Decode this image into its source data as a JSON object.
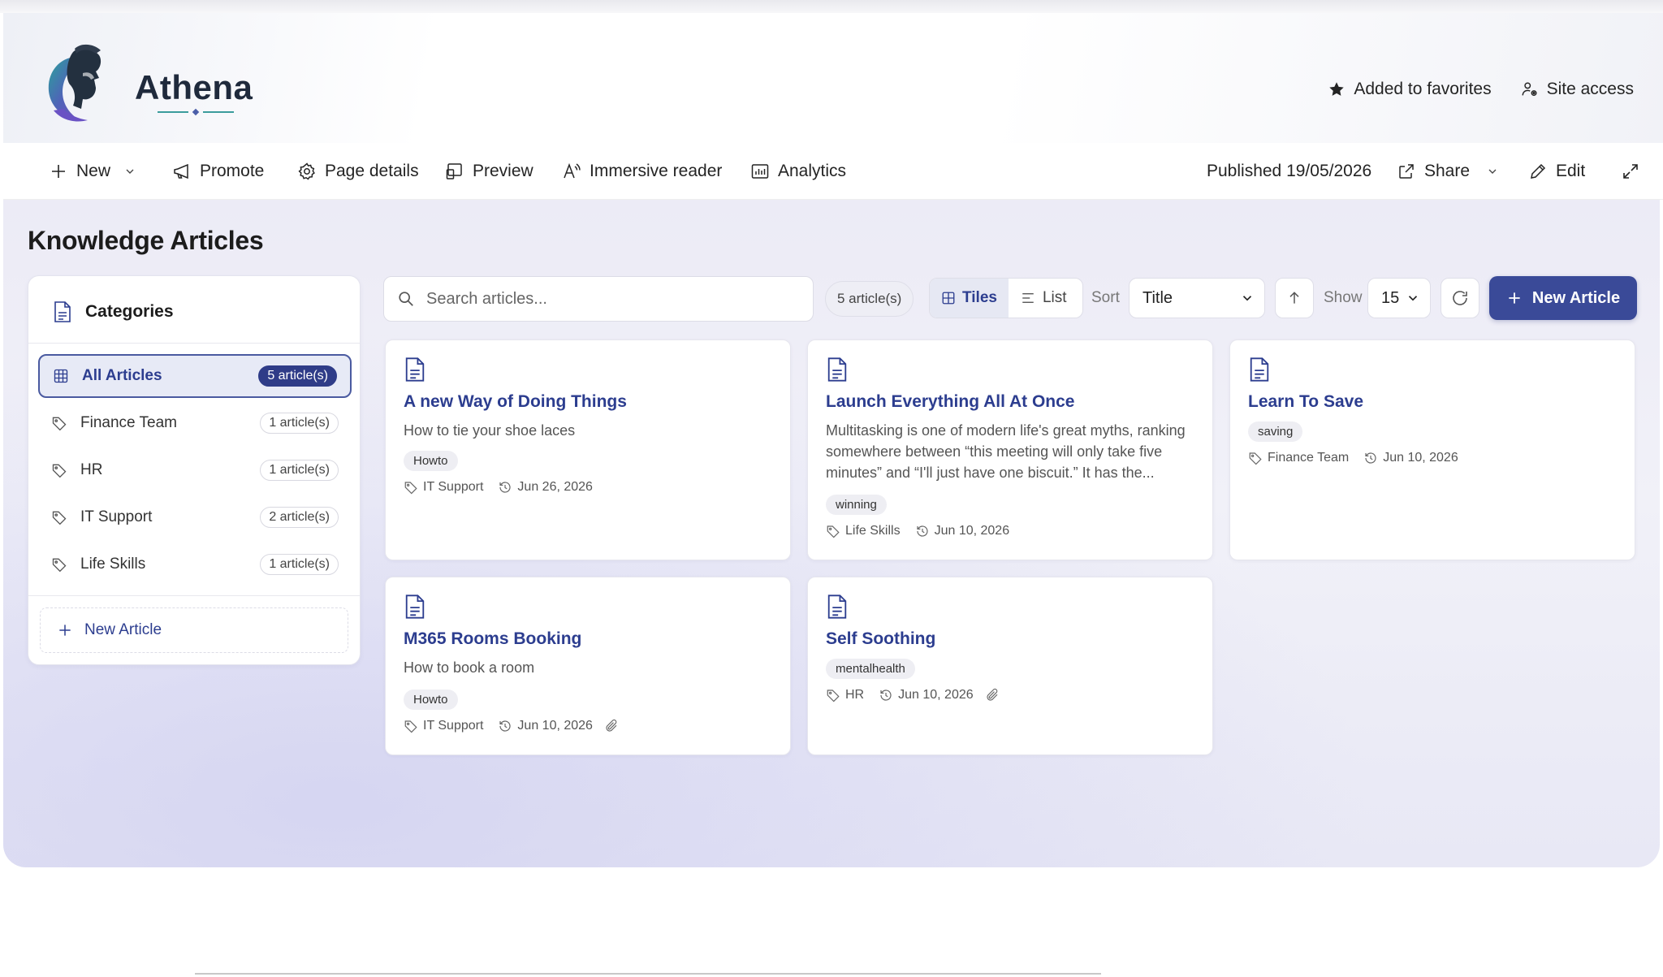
{
  "site": {
    "title": "Athena",
    "favorite_label": "Added to favorites",
    "site_access_label": "Site access"
  },
  "command_bar": {
    "new_label": "New",
    "promote_label": "Promote",
    "page_details_label": "Page details",
    "preview_label": "Preview",
    "immersive_reader_label": "Immersive reader",
    "analytics_label": "Analytics",
    "published_label": "Published 19/05/2026",
    "share_label": "Share",
    "edit_label": "Edit"
  },
  "page": {
    "title": "Knowledge Articles"
  },
  "sidebar": {
    "header": "Categories",
    "items": [
      {
        "label": "All Articles",
        "count": "5 article(s)",
        "active": true
      },
      {
        "label": "Finance Team",
        "count": "1 article(s)"
      },
      {
        "label": "HR",
        "count": "1 article(s)"
      },
      {
        "label": "IT Support",
        "count": "2 article(s)"
      },
      {
        "label": "Life Skills",
        "count": "1 article(s)"
      }
    ],
    "new_article_label": "New Article"
  },
  "toolbar": {
    "search_placeholder": "Search articles...",
    "article_count": "5 article(s)",
    "tiles_label": "Tiles",
    "list_label": "List",
    "sort_label": "Sort",
    "sort_value": "Title",
    "show_label": "Show",
    "show_value": "15",
    "new_article_label": "New Article"
  },
  "articles": [
    {
      "title": "A new Way of Doing Things",
      "description": "How to tie your shoe laces",
      "tag": "Howto",
      "category": "IT Support",
      "date": "Jun 26, 2026",
      "attachment": false
    },
    {
      "title": "Launch Everything All At Once",
      "description": "Multitasking is one of modern life's great myths, ranking somewhere between “this meeting will only take five minutes” and “I'll just have one biscuit.” It has the...",
      "tag": "winning",
      "category": "Life Skills",
      "date": "Jun 10, 2026",
      "attachment": false
    },
    {
      "title": "Learn To Save",
      "description": "",
      "tag": "saving",
      "category": "Finance Team",
      "date": "Jun 10, 2026",
      "attachment": false
    },
    {
      "title": "M365 Rooms Booking",
      "description": "How to book a room",
      "tag": "Howto",
      "category": "IT Support",
      "date": "Jun 10, 2026",
      "attachment": true
    },
    {
      "title": "Self Soothing",
      "description": "",
      "tag": "mentalhealth",
      "category": "HR",
      "date": "Jun 10, 2026",
      "attachment": true
    }
  ],
  "colors": {
    "accent": "#3a4a98",
    "title_link": "#2c3d8f",
    "canvas_bg": "#ecebf6"
  }
}
